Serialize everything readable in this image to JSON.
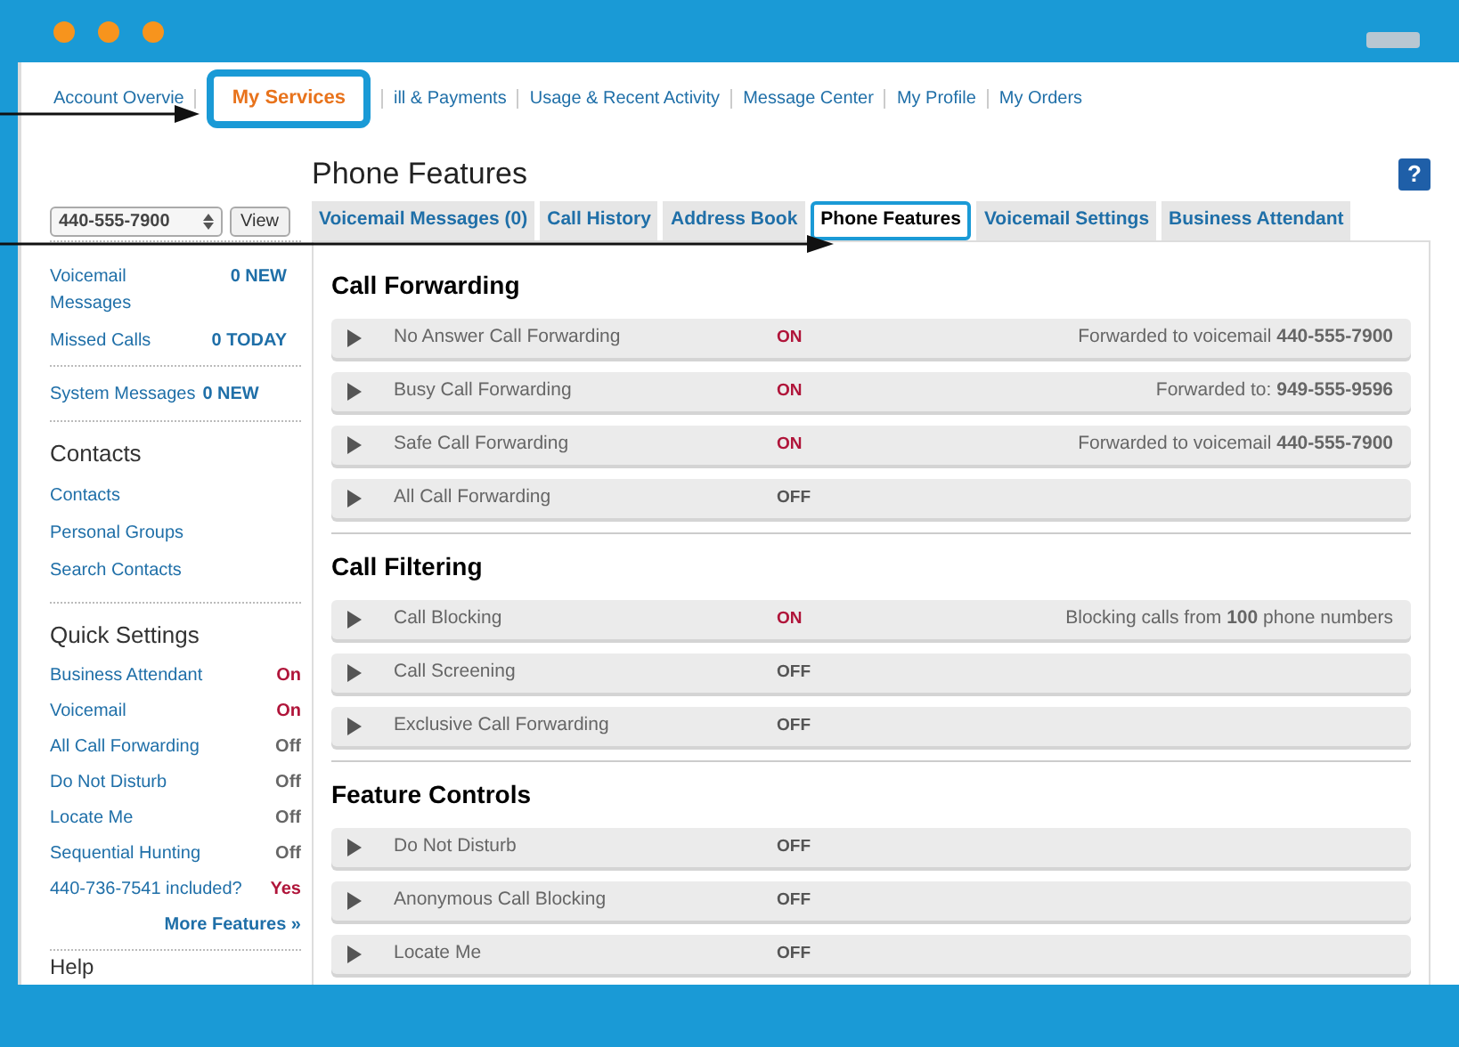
{
  "nav": [
    {
      "label": "Account Overvie",
      "selected": false
    },
    {
      "label": "My Services",
      "selected": true
    },
    {
      "label": "ill & Payments",
      "selected": false
    },
    {
      "label": "Usage & Recent Activity",
      "selected": false
    },
    {
      "label": "Message Center",
      "selected": false
    },
    {
      "label": "My Profile",
      "selected": false
    },
    {
      "label": "My Orders",
      "selected": false
    }
  ],
  "page_title": "Phone Features",
  "help_button": "?",
  "phone_select": {
    "value": "440-555-7900"
  },
  "view_button": "View",
  "tabs": [
    {
      "label": "Voicemail Messages (0)",
      "selected": false
    },
    {
      "label": "Call History",
      "selected": false
    },
    {
      "label": "Address Book",
      "selected": false
    },
    {
      "label": "Phone Features",
      "selected": true
    },
    {
      "label": "Voicemail Settings",
      "selected": false
    },
    {
      "label": "Business Attendant",
      "selected": false
    }
  ],
  "sidebar": {
    "summary": [
      {
        "label": "Voicemail Messages",
        "count": "0 NEW"
      },
      {
        "label": "Missed Calls",
        "count": "0 TODAY"
      }
    ],
    "system": [
      {
        "label": "System Messages",
        "count": "0 NEW"
      }
    ],
    "contacts": {
      "title": "Contacts",
      "links": [
        "Contacts",
        "Personal Groups",
        "Search Contacts"
      ]
    },
    "quick_settings": {
      "title": "Quick Settings",
      "items": [
        {
          "label": "Business Attendant",
          "value": "On",
          "on": true
        },
        {
          "label": "Voicemail",
          "value": "On",
          "on": true
        },
        {
          "label": "All Call Forwarding",
          "value": "Off",
          "on": false
        },
        {
          "label": "Do Not Disturb",
          "value": "Off",
          "on": false
        },
        {
          "label": "Locate Me",
          "value": "Off",
          "on": false
        },
        {
          "label": "Sequential Hunting",
          "value": "Off",
          "on": false
        },
        {
          "label": "440-736-7541 included?",
          "value": "Yes",
          "on": true
        }
      ],
      "more": "More Features »"
    },
    "help_title": "Help"
  },
  "sections": [
    {
      "title": "Call Forwarding",
      "rows": [
        {
          "name": "No Answer Call Forwarding",
          "status": "ON",
          "on": true,
          "detail": "Forwarded to voicemail **440-555-7900**"
        },
        {
          "name": "Busy Call Forwarding",
          "status": "ON",
          "on": true,
          "detail": "Forwarded to: **949-555-9596**"
        },
        {
          "name": "Safe Call Forwarding",
          "status": "ON",
          "on": true,
          "detail": "Forwarded to voicemail **440-555-7900**"
        },
        {
          "name": "All Call Forwarding",
          "status": "OFF",
          "on": false
        }
      ]
    },
    {
      "title": "Call Filtering",
      "rows": [
        {
          "name": "Call Blocking",
          "status": "ON",
          "on": true,
          "detail": "Blocking calls from **100** phone numbers"
        },
        {
          "name": "Call Screening",
          "status": "OFF",
          "on": false
        },
        {
          "name": "Exclusive Call Forwarding",
          "status": "OFF",
          "on": false
        }
      ]
    },
    {
      "title": "Feature Controls",
      "rows": [
        {
          "name": "Do Not Disturb",
          "status": "OFF",
          "on": false
        },
        {
          "name": "Anonymous Call Blocking",
          "status": "OFF",
          "on": false
        },
        {
          "name": "Locate Me",
          "status": "OFF",
          "on": false
        }
      ]
    }
  ]
}
